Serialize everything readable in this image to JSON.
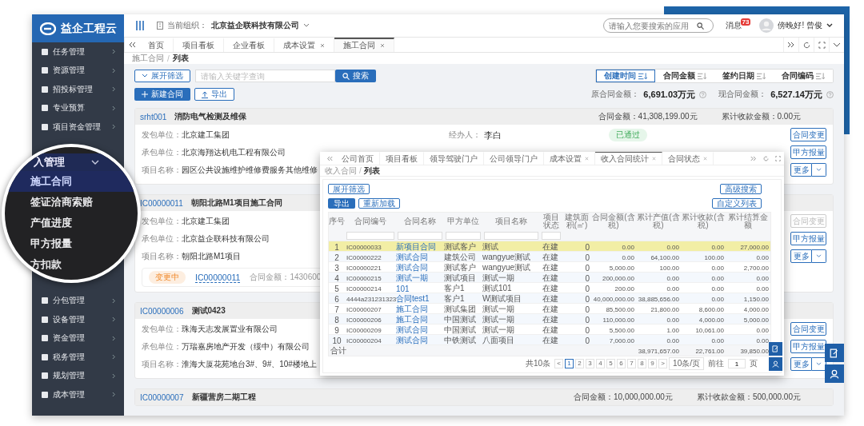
{
  "sidebar": {
    "logo": "益企工程云",
    "items_top": [
      "任务管理",
      "资源管理",
      "招投标管理",
      "专业预算",
      "项目资金管理"
    ],
    "items_bottom": [
      "分包管理",
      "设备管理",
      "资金管理",
      "税务管理",
      "规划管理",
      "成本管理"
    ]
  },
  "magnifier": {
    "group": "入管理",
    "expanded": true,
    "items": [
      {
        "label": "施工合同",
        "selected": true
      },
      {
        "label": "签证洽商索赔",
        "selected": false
      },
      {
        "label": "产值进度",
        "selected": false
      },
      {
        "label": "甲方报量",
        "selected": false
      },
      {
        "label": "方扣款",
        "selected": false
      }
    ]
  },
  "header": {
    "org_label": "当前组织：",
    "org": "北京益企联科技有限公司",
    "search_placeholder": "请输入您要搜索的应用",
    "messages": "消息",
    "badge": "73",
    "greeting": "傍晚好! 曾俊"
  },
  "tabs": [
    {
      "label": "首页",
      "closable": false,
      "selected": false
    },
    {
      "label": "项目看板",
      "closable": false,
      "selected": false
    },
    {
      "label": "企业看板",
      "closable": false,
      "selected": false
    },
    {
      "label": "成本设置",
      "closable": true,
      "selected": false
    },
    {
      "label": "施工合同",
      "closable": true,
      "selected": true
    }
  ],
  "breadcrumb": {
    "items": [
      "施工合同",
      "列表"
    ],
    "separator": "/"
  },
  "toolbar": {
    "filter": "展开筛选",
    "search_placeholder": "请输入关键字查询",
    "search": "搜索",
    "create": "新建合同",
    "export": "导出"
  },
  "sort_buttons": [
    {
      "label": "创建时间",
      "selected": true
    },
    {
      "label": "合同金额",
      "selected": false
    },
    {
      "label": "签约日期",
      "selected": false
    },
    {
      "label": "合同编码",
      "selected": false
    }
  ],
  "totals": [
    {
      "label": "原合同金额：",
      "value": "6,691.03万元"
    },
    {
      "label": "现合同金额：",
      "value": "6,527.14万元"
    }
  ],
  "contracts": [
    {
      "code": "srht001",
      "title": "消防电气检测及维保",
      "amount": "合同金额：41,308,199.00元",
      "received": "累计收款金额：0.00元",
      "fields": [
        {
          "label": "发包单位：",
          "value": "北京建工集团"
        },
        {
          "label": "承包单位：",
          "value": "北京海翔达机电工程有限公司"
        },
        {
          "label": "项目名称：",
          "value": "园区公共设施维护维修费服务其他维修"
        }
      ],
      "handler": {
        "label": "经办人：",
        "value": "李白"
      },
      "status": {
        "label": "已通过",
        "kind": "approved"
      },
      "buttons": [
        {
          "label": "合同变更",
          "kind": "button",
          "disabled": false
        },
        {
          "label": "甲方报量",
          "kind": "button",
          "disabled": false
        },
        {
          "label": "更多",
          "kind": "dropdown",
          "disabled": false
        }
      ]
    },
    {
      "code": "IC00000011",
      "title": "朝阳北路M1项目施工合同",
      "fields": [
        {
          "label": "发包单位：",
          "value": "北京建工集团"
        },
        {
          "label": "承包单位：",
          "value": "北京益企联科技有限公司"
        },
        {
          "label": "项目名称：",
          "value": "朝阳北路M1项目"
        }
      ],
      "change": {
        "status": "变更中",
        "code": "IC00000011",
        "amount": "合同金额：1430600"
      },
      "buttons": [
        {
          "label": "合同变更",
          "kind": "button",
          "disabled": true
        },
        {
          "label": "甲方报量",
          "kind": "button",
          "disabled": false
        },
        {
          "label": "更多",
          "kind": "dropdown",
          "disabled": false
        }
      ]
    },
    {
      "code": "IC00000006",
      "title": "测试0423",
      "fields": [
        {
          "label": "发包单位：",
          "value": "珠海天志发展置业有限公司"
        },
        {
          "label": "承包单位：",
          "value": "万瑞嘉房地产开发（绥中）有限公司"
        },
        {
          "label": "项目名称：",
          "value": "淮海大厦花苑地台3#、9#、10#楼地上"
        }
      ],
      "buttons": [
        {
          "label": "合同变更",
          "kind": "button",
          "disabled": false
        },
        {
          "label": "甲方报量",
          "kind": "button",
          "disabled": false
        },
        {
          "label": "更多",
          "kind": "dropdown",
          "disabled": false
        }
      ]
    },
    {
      "code": "IC00000007",
      "title": "新疆营房二期工程",
      "amount": "合同金额：10,000,000.00元",
      "received": "累计收款金额：500,000.00元"
    }
  ],
  "inset": {
    "tabs": [
      {
        "label": "公司首页",
        "closable": false,
        "selected": false
      },
      {
        "label": "项目看板",
        "closable": false,
        "selected": false
      },
      {
        "label": "领导驾驶门户",
        "closable": false,
        "selected": false
      },
      {
        "label": "公司领导门户",
        "closable": false,
        "selected": false
      },
      {
        "label": "成本设置",
        "closable": true,
        "selected": false
      },
      {
        "label": "收入合同统计",
        "closable": true,
        "selected": true
      },
      {
        "label": "合同状态",
        "closable": true,
        "selected": false
      }
    ],
    "breadcrumb": {
      "items": [
        "收入合同",
        "列表"
      ],
      "separator": "/"
    },
    "filter": "展开筛选",
    "export": "导出",
    "reload": "重新加载",
    "advanced": "高级搜索",
    "custom": "自定义列表",
    "columns": [
      "序号",
      "合同编号",
      "合同名称",
      "甲方单位",
      "项目名称",
      "项目状态",
      "建筑面积(㎡)",
      "合同金额(含税)",
      "累计产值(含税)",
      "累计收款(含税)",
      "累计结算金额"
    ],
    "rows": [
      {
        "selected": true,
        "cells": [
          "1",
          "IC00000033",
          "新项目合同",
          "测试客户",
          "测试",
          "在建",
          "0",
          "0.00",
          "0.00",
          "0.00",
          "27,000.00"
        ]
      },
      {
        "selected": false,
        "cells": [
          "2",
          "IC00000222",
          "测试合同",
          "建筑公司",
          "wangyue测试",
          "在建",
          "0",
          "0.00",
          "64,100.00",
          "100.00",
          "0.00"
        ]
      },
      {
        "selected": false,
        "cells": [
          "3",
          "IC00000221",
          "测试合同",
          "测试客户",
          "wangyue测试",
          "在建",
          "0",
          "5,000.00",
          "100.00",
          "0.00",
          "2,700.00"
        ]
      },
      {
        "selected": false,
        "cells": [
          "4",
          "IC00000215",
          "测试一期",
          "测试项目",
          "测试一期",
          "在建",
          "0",
          "200,000.00",
          "0.00",
          "0.00",
          "0.00"
        ]
      },
      {
        "selected": false,
        "cells": [
          "5",
          "IC00000214",
          "101",
          "客户1",
          "测试101",
          "在建",
          "0",
          "200.00",
          "0.00",
          "0.00",
          "0.00"
        ]
      },
      {
        "selected": false,
        "cells": [
          "6",
          "4444a231231323",
          "合同test1",
          "客户1",
          "W测试项目",
          "在建",
          "0",
          "40,000,000.00",
          "38,885,656.00",
          "0.00",
          "1,150.00"
        ]
      },
      {
        "selected": false,
        "cells": [
          "7",
          "IC00000207",
          "施工合同",
          "测试集团",
          "测试一期",
          "在建",
          "0",
          "85,500.00",
          "21,800.00",
          "8,600.00",
          "4,000.00"
        ]
      },
      {
        "selected": false,
        "cells": [
          "8",
          "IC00000206",
          "施工合同",
          "中国测试",
          "测试一期",
          "在建",
          "0",
          "110,000.00",
          "0.00",
          "4,000.00",
          "5,000.00"
        ]
      },
      {
        "selected": false,
        "cells": [
          "9",
          "IC00000209",
          "测试合同",
          "中国测试",
          "测试一期",
          "在建",
          "0",
          "5,500.00",
          "1.00",
          "10,061.00",
          "0.00"
        ]
      },
      {
        "selected": false,
        "cells": [
          "10",
          "IC00000204",
          "测试合同",
          "中铁测试",
          "八面项目",
          "在建",
          "0",
          "7,000.00",
          "0.00",
          "0.00",
          "0.00"
        ]
      }
    ],
    "total": {
      "label": "合计",
      "accrued": "38,971,657.00",
      "received": "22,761.00",
      "settled": "39,850.00"
    },
    "pagination": {
      "total": "共10条",
      "prev": "<",
      "next": ">",
      "pages": [
        {
          "label": "1",
          "selected": true
        },
        {
          "label": "2",
          "selected": false
        },
        {
          "label": "3",
          "selected": false
        },
        {
          "label": "4",
          "selected": false
        },
        {
          "label": "5",
          "selected": false
        },
        {
          "label": "6",
          "selected": false
        },
        {
          "label": "7",
          "selected": false
        },
        {
          "label": "8",
          "selected": false
        },
        {
          "label": "9",
          "selected": false
        }
      ],
      "page_size": "10条/页",
      "goto": "前往",
      "page_input": "1",
      "page_unit": "页"
    }
  }
}
